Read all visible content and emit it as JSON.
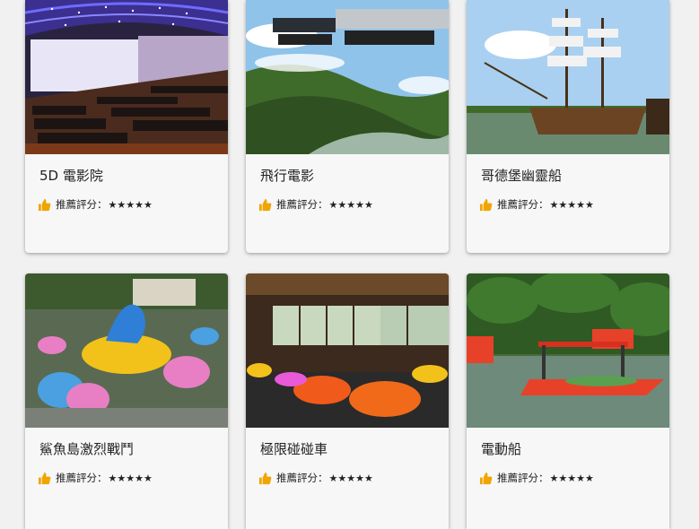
{
  "attractions": [
    {
      "title": "5D 電影院",
      "rating_label": "推薦評分：",
      "stars": "★★★★★"
    },
    {
      "title": "飛行電影",
      "rating_label": "推薦評分：",
      "stars": "★★★★★"
    },
    {
      "title": "哥德堡幽靈船",
      "rating_label": "推薦評分：",
      "stars": "★★★★★"
    },
    {
      "title": "鯊魚島激烈戰鬥",
      "rating_label": "推薦評分：",
      "stars": "★★★★★"
    },
    {
      "title": "極限碰碰車",
      "rating_label": "推薦評分：",
      "stars": "★★★★★"
    },
    {
      "title": "電動船",
      "rating_label": "推薦評分：",
      "stars": "★★★★★"
    }
  ],
  "colors": {
    "accent_thumb": "#f0a500",
    "card_bg": "#f7f7f7",
    "page_bg": "#f1f1f1"
  },
  "icons": {
    "rating": "thumbs-up-icon"
  }
}
